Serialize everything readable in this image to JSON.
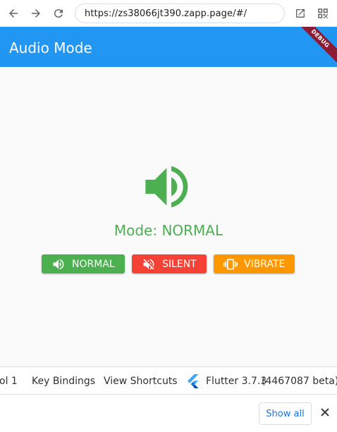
{
  "browser": {
    "url": "https://zs38066jt390.zapp.page/#/",
    "icons": [
      "back-arrow-icon",
      "forward-arrow-icon",
      "reload-icon",
      "open-external-icon",
      "qr-code-icon"
    ]
  },
  "appbar": {
    "title": "Audio Mode",
    "debug_label": "DEBUG",
    "color": "#2196f3"
  },
  "main": {
    "mode_text": "Mode: NORMAL",
    "current_mode": "NORMAL",
    "mode_color": "#4caf50",
    "buttons": [
      {
        "label": "NORMAL",
        "icon": "volume-up-icon",
        "color": "#4caf50"
      },
      {
        "label": "SILENT",
        "icon": "volume-off-icon",
        "color": "#f44336"
      },
      {
        "label": "VIBRATE",
        "icon": "vibration-icon",
        "color": "#ff9800"
      }
    ]
  },
  "devtools": {
    "items": [
      "ol 1",
      "Key Bindings",
      "View Shortcuts"
    ],
    "flutter_version": "Flutter 3.7.3",
    "build": "(4467087 beta)"
  },
  "bottom": {
    "show_all_label": "Show all"
  }
}
